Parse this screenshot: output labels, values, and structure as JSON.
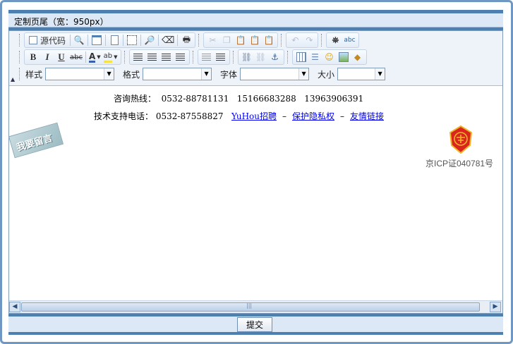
{
  "panel": {
    "title": "定制页尾（宽：950px）"
  },
  "toolbar": {
    "source_label": "源代码",
    "style_label": "样式",
    "format_label": "格式",
    "font_label": "字体",
    "size_label": "大小",
    "bold": "B",
    "italic": "I",
    "underline": "U",
    "strike": "abc",
    "spell": "abc",
    "text_color": "A",
    "bg_color": "ab"
  },
  "content": {
    "hotline_label": "咨询热线：",
    "hotline_numbers": [
      "0532-88781131",
      "15166683288",
      "13963906391"
    ],
    "support_label": "技术支持电话：",
    "support_number": "0532-87558827",
    "links": [
      "YuHou招聘",
      "保护隐私权",
      "友情链接"
    ],
    "link_separator": "–",
    "note_badge": "我要留言",
    "icp_text": "京ICP证040781号"
  },
  "submit_label": "提交",
  "colors": {
    "frame": "#6f97c4",
    "bar": "#4d7fb0",
    "title_bg": "#dce8f5",
    "link": "#0000ee",
    "seal_red": "#d9251d",
    "seal_gold": "#f0b428"
  }
}
